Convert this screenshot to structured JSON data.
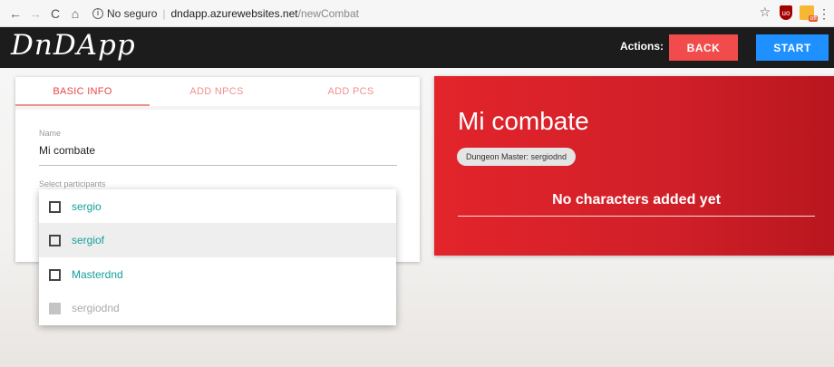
{
  "browser": {
    "back_glyph": "←",
    "forward_glyph": "→",
    "reload_glyph": "C",
    "home_glyph": "⌂",
    "info_glyph": "i",
    "security_text": "No seguro",
    "url_host": "dndapp.azurewebsites.net",
    "url_path": "/newCombat",
    "star_glyph": "☆",
    "kebab_glyph": "⋮",
    "ext_ublock_text": "uo",
    "ext_offer_tag": "off"
  },
  "header": {
    "logo": "DnDApp",
    "actions_label": "Actions:",
    "back_label": "BACK",
    "start_label": "START",
    "colors": {
      "back": "#f24b4b",
      "start": "#1e90ff",
      "bar": "#1c1c1c"
    }
  },
  "tabs": [
    {
      "label": "BASIC INFO",
      "active": true
    },
    {
      "label": "ADD NPCS",
      "active": false
    },
    {
      "label": "ADD PCS",
      "active": false
    }
  ],
  "form": {
    "name_label": "Name",
    "name_value": "Mi combate",
    "participants_label": "Select participants"
  },
  "participants": [
    {
      "label": "sergio",
      "checked": false,
      "disabled": false,
      "highlighted": false
    },
    {
      "label": "sergiof",
      "checked": false,
      "disabled": false,
      "highlighted": true
    },
    {
      "label": "Masterdnd",
      "checked": false,
      "disabled": false,
      "highlighted": false
    },
    {
      "label": "sergiodnd",
      "checked": false,
      "disabled": true,
      "highlighted": false
    }
  ],
  "combat": {
    "title": "Mi combate",
    "dm_chip": "Dungeon Master: sergiodnd",
    "empty_message": "No characters added yet",
    "accent_color": "#e3242b"
  }
}
